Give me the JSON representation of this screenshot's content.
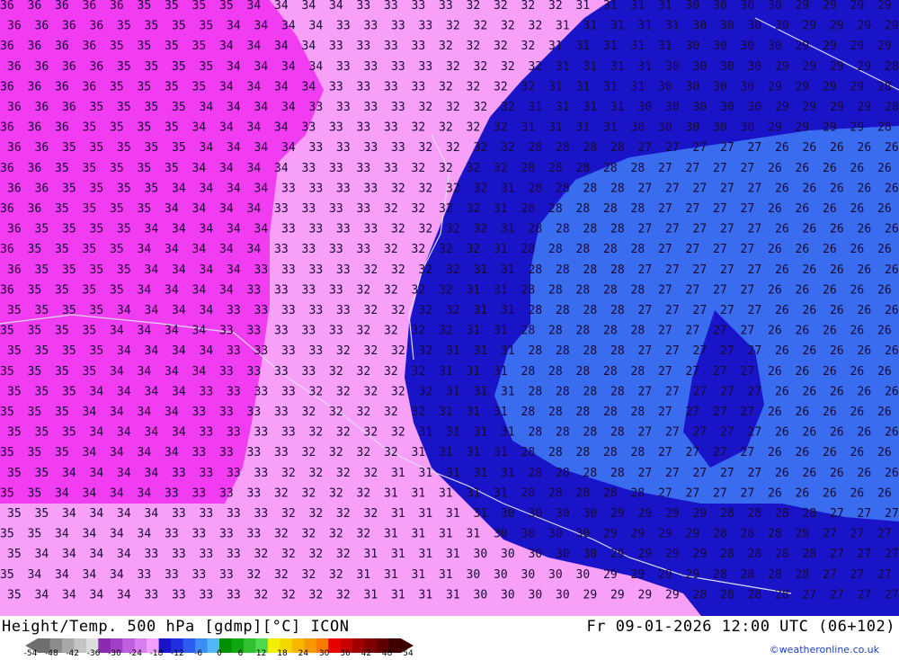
{
  "map": {
    "colors": {
      "deep_magenta": "#f23cf2",
      "light_pink": "#f8a0f8",
      "dark_blue": "#1a14c8",
      "mid_blue": "#3a6cf0",
      "lavender": "#ff80ff"
    },
    "contour_values": [
      "36",
      "35",
      "34",
      "33",
      "32",
      "31",
      "30",
      "29",
      "28",
      "27",
      "26",
      "25"
    ]
  },
  "footer": {
    "title_left": "Height/Temp. 500 hPa [gdmp][°C] ICON",
    "title_right": "Fr 09-01-2026 12:00 UTC (06+102)",
    "credit": "©weatheronline.co.uk"
  },
  "legend": {
    "ticks": [
      "-54",
      "-48",
      "-42",
      "-36",
      "-30",
      "-24",
      "-18",
      "-12",
      "-6",
      "0",
      "6",
      "12",
      "18",
      "24",
      "30",
      "36",
      "42",
      "48",
      "54"
    ],
    "colors": [
      "#6e6e6e",
      "#8c8c8c",
      "#a8a8a8",
      "#c4c4c4",
      "#dcdcdc",
      "#8a2bb0",
      "#a340c8",
      "#c060e0",
      "#d87ef0",
      "#f0a0f8",
      "#1a14c8",
      "#2030e0",
      "#2c5cf0",
      "#3c8cf8",
      "#50b8f8",
      "#009000",
      "#10a810",
      "#30c030",
      "#50d850",
      "#f0f000",
      "#f0d800",
      "#f8b800",
      "#f89800",
      "#f87800",
      "#e80000",
      "#c80000",
      "#a00000",
      "#800000",
      "#600000",
      "#400000"
    ]
  }
}
